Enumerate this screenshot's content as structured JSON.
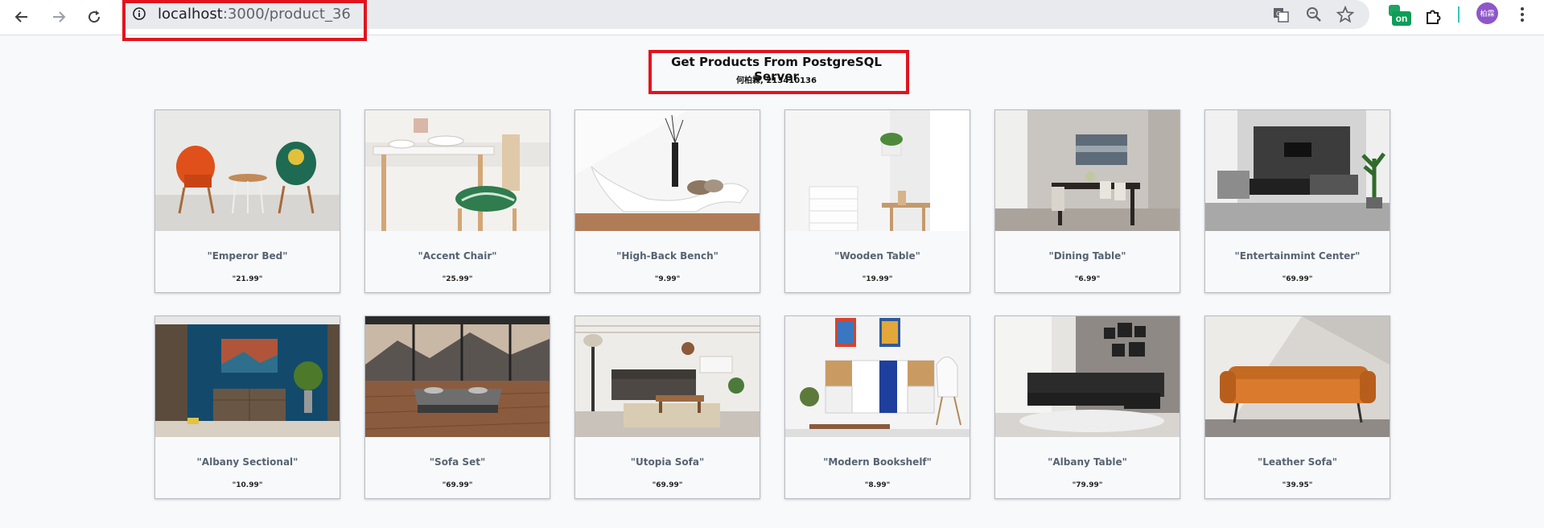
{
  "browser": {
    "url_host": "localhost",
    "url_path": ":3000/product_36",
    "profile_initials": "柏霖",
    "extension_badge": "on"
  },
  "page": {
    "title": "Get Products From PostgreSQL Server",
    "subtitle": "何柏霖, 213410136"
  },
  "products": [
    {
      "name": "\"Emperor Bed\"",
      "price": "\"21.99\""
    },
    {
      "name": "\"Accent Chair\"",
      "price": "\"25.99\""
    },
    {
      "name": "\"High-Back Bench\"",
      "price": "\"9.99\""
    },
    {
      "name": "\"Wooden Table\"",
      "price": "\"19.99\""
    },
    {
      "name": "\"Dining Table\"",
      "price": "\"6.99\""
    },
    {
      "name": "\"Entertainmint Center\"",
      "price": "\"69.99\""
    },
    {
      "name": "\"Albany Sectional\"",
      "price": "\"10.99\""
    },
    {
      "name": "\"Sofa Set\"",
      "price": "\"69.99\""
    },
    {
      "name": "\"Utopia Sofa\"",
      "price": "\"69.99\""
    },
    {
      "name": "\"Modern Bookshelf\"",
      "price": "\"8.99\""
    },
    {
      "name": "\"Albany Table\"",
      "price": "\"79.99\""
    },
    {
      "name": "\"Leather Sofa\"",
      "price": "\"39.95\""
    }
  ],
  "colors": {
    "annotation_box": "#e1141e",
    "page_bg": "#f8f9fb",
    "product_name": "#566372"
  }
}
